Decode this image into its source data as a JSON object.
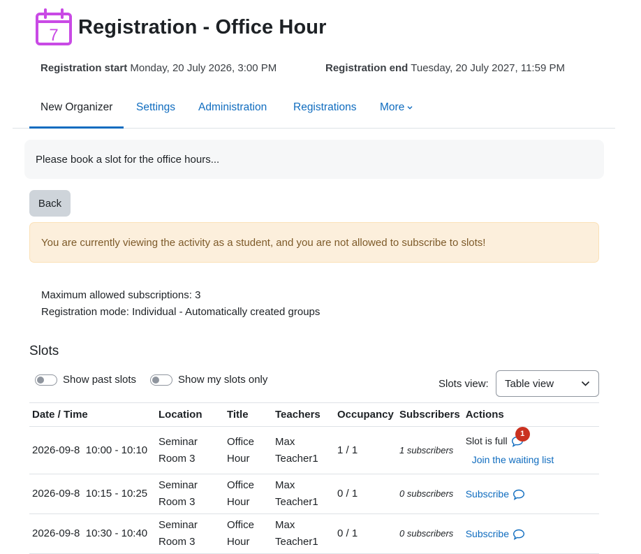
{
  "header": {
    "title": "Registration - Office Hour",
    "icon": "calendar-icon",
    "icon_day": "7",
    "icon_color": "#c94ae5"
  },
  "dates": {
    "start_label": "Registration start",
    "start_value": "Monday, 20 July 2026, 3:00 PM",
    "end_label": "Registration end",
    "end_value": "Tuesday, 20 July 2027, 11:59 PM"
  },
  "tabs": [
    {
      "label": "New Organizer",
      "active": true
    },
    {
      "label": "Settings"
    },
    {
      "label": "Administration"
    },
    {
      "label": "Registrations"
    },
    {
      "label": "More"
    }
  ],
  "intro": "Please book a slot for the office hours...",
  "back_label": "Back",
  "alert": "You are currently viewing the activity as a student, and you are not allowed to subscribe to slots!",
  "info": {
    "max_subscriptions": "Maximum allowed subscriptions: 3",
    "registration_mode": "Registration mode: Individual - Automatically created groups"
  },
  "slots": {
    "title": "Slots",
    "toggle_past": "Show past slots",
    "toggle_mine": "Show my slots only",
    "view_label": "Slots view:",
    "view_selected": "Table view",
    "columns": [
      "Date / Time",
      "Location",
      "Title",
      "Teachers",
      "Occupancy",
      "Subscribers",
      "Actions"
    ],
    "rows": [
      {
        "date": "2026-09-8",
        "time": "10:00 - 10:10",
        "location_1": "Seminar",
        "location_2": "Room 3",
        "title_1": "Office",
        "title_2": "Hour",
        "teacher_1": "Max",
        "teacher_2": "Teacher1",
        "occupancy": "1 / 1",
        "subscribers": "1 subscribers",
        "action": "Slot is full",
        "comment_count": "1",
        "secondary_action": "Join the waiting list"
      },
      {
        "date": "2026-09-8",
        "time": "10:15 - 10:25",
        "location_1": "Seminar",
        "location_2": "Room 3",
        "title_1": "Office",
        "title_2": "Hour",
        "teacher_1": "Max",
        "teacher_2": "Teacher1",
        "occupancy": "0 / 1",
        "subscribers": "0 subscribers",
        "action": "Subscribe"
      },
      {
        "date": "2026-09-8",
        "time": "10:30 - 10:40",
        "location_1": "Seminar",
        "location_2": "Room 3",
        "title_1": "Office",
        "title_2": "Hour",
        "teacher_1": "Max",
        "teacher_2": "Teacher1",
        "occupancy": "0 / 1",
        "subscribers": "0 subscribers",
        "action": "Subscribe"
      }
    ]
  },
  "colors": {
    "link": "#0f6cbf",
    "alert_bg": "#fcefdc",
    "alert_text": "#7d5a29",
    "badge": "#ca3120"
  }
}
